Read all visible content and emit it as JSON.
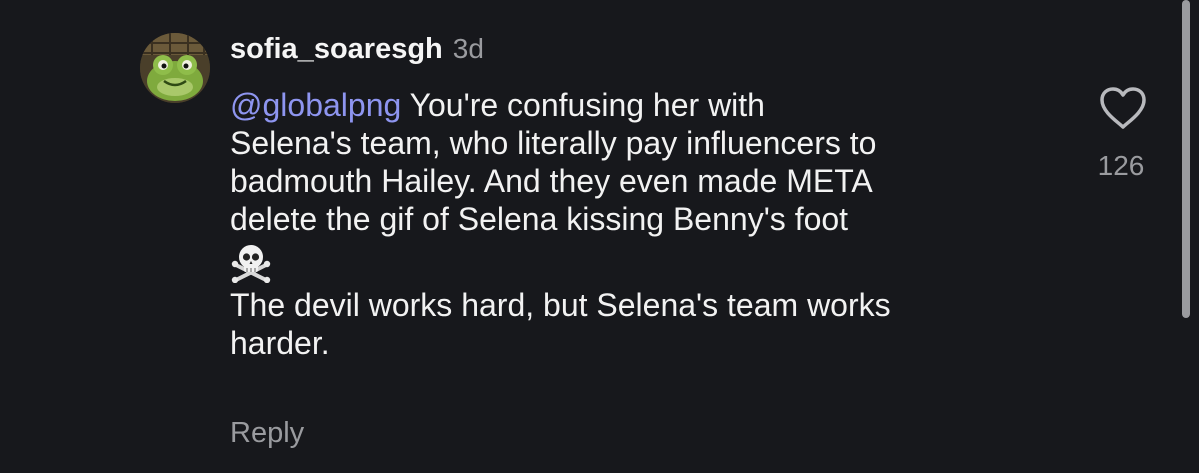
{
  "comment": {
    "username": "sofia_soaresgh",
    "timestamp": "3d",
    "mention": "@globalpng",
    "lines": [
      " You're confusing her with",
      "Selena's team, who literally pay influencers to",
      "badmouth Hailey. And they even made META",
      "delete the gif of Selena kissing Benny's foot"
    ],
    "emoji": "skull-and-crossbones",
    "closing_lines": [
      "The devil works hard, but Selena's team works",
      "harder."
    ],
    "reply_label": "Reply",
    "like_count": "126",
    "like_icon": "heart-outline-icon",
    "colors": {
      "background": "#17181c",
      "text": "#f2f2f2",
      "muted": "#9a9b9f",
      "mention": "#8e95f0"
    }
  }
}
